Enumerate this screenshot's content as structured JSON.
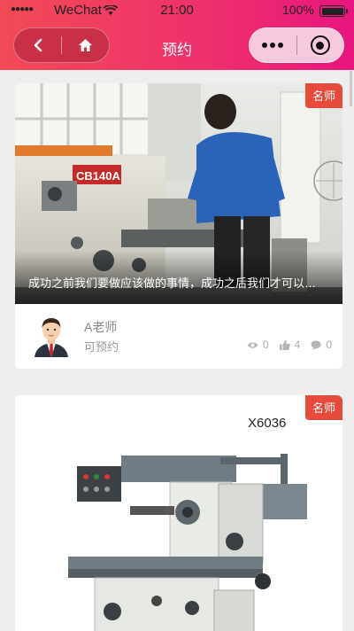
{
  "status_bar": {
    "signal": "●●●●●",
    "carrier": "WeChat",
    "time": "21:00",
    "battery": "100%"
  },
  "nav": {
    "title": "预约",
    "back_icon": "chevron-left-icon",
    "home_icon": "home-icon",
    "more_icon": "more-dots-icon",
    "close_icon": "target-circle-icon"
  },
  "colors": {
    "header_start": "#f24a55",
    "header_end": "#e8157f",
    "badge": "#e64a3b",
    "page_bg": "#eeeeee"
  },
  "cards": [
    {
      "badge": "名师",
      "image": "lathe machine with worker in blue shirt",
      "image_label": "CB140A",
      "caption": "成功之前我们要做应该做的事情，成功之后我们才可以做喜欢做的事情。",
      "teacher": "A老师",
      "status": "可预约",
      "views": "0",
      "likes": "4",
      "comments": "0"
    },
    {
      "badge": "名师",
      "image": "milling machine",
      "image_label": "X6036"
    }
  ]
}
